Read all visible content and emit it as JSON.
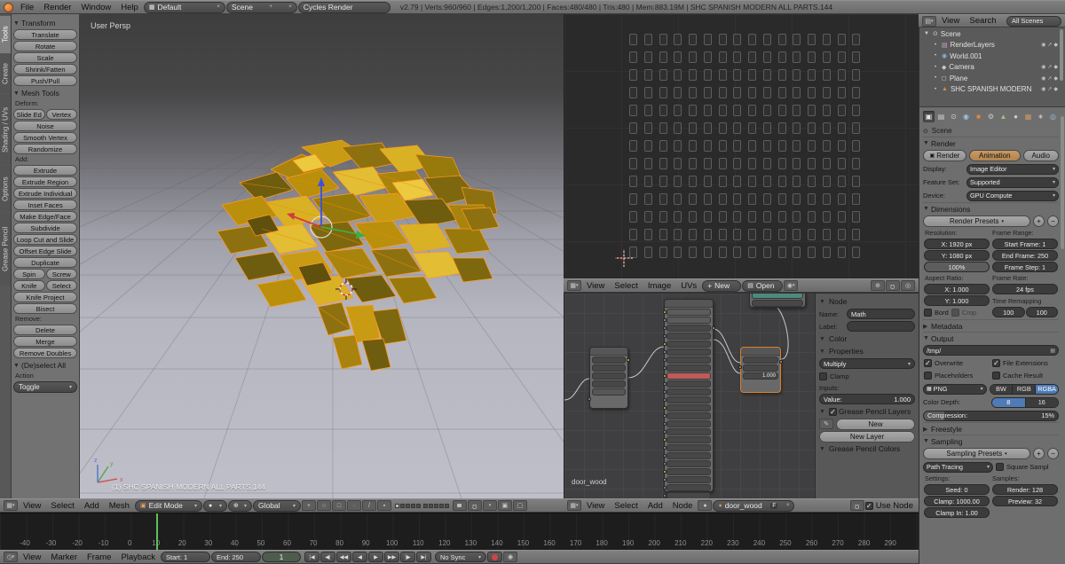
{
  "topbar": {
    "menus": [
      "File",
      "Render",
      "Window",
      "Help"
    ],
    "layout": "Default",
    "scene": "Scene",
    "engine": "Cycles Render",
    "stats": "v2.79 | Verts:960/960 | Edges:1,200/1,200 | Faces:480/480 | Tris:480 | Mem:883.19M | SHC SPANISH MODERN ALL PARTS.144"
  },
  "toolshelf": {
    "tabs": [
      "Tools",
      "Create",
      "Shading / UVs",
      "Options",
      "Grease Pencil"
    ],
    "items": [
      {
        "t": "header",
        "label": "Transform"
      },
      {
        "t": "btn",
        "label": "Translate"
      },
      {
        "t": "btn",
        "label": "Rotate"
      },
      {
        "t": "btn",
        "label": "Scale"
      },
      {
        "t": "btn",
        "label": "Shrink/Fatten"
      },
      {
        "t": "btn",
        "label": "Push/Pull"
      },
      {
        "t": "header",
        "label": "Mesh Tools"
      },
      {
        "t": "label",
        "label": "Deform:"
      },
      {
        "t": "row",
        "labels": [
          "Slide Ed",
          "Vertex"
        ]
      },
      {
        "t": "btn",
        "label": "Noise"
      },
      {
        "t": "btn",
        "label": "Smooth Vertex"
      },
      {
        "t": "btn",
        "label": "Randomize"
      },
      {
        "t": "label",
        "label": "Add:"
      },
      {
        "t": "btn",
        "label": "Extrude"
      },
      {
        "t": "btn",
        "label": "Extrude Region"
      },
      {
        "t": "btn",
        "label": "Extrude Individual"
      },
      {
        "t": "btn",
        "label": "Inset Faces"
      },
      {
        "t": "btn",
        "label": "Make Edge/Face"
      },
      {
        "t": "btn",
        "label": "Subdivide"
      },
      {
        "t": "btn",
        "label": "Loop Cut and Slide"
      },
      {
        "t": "btn",
        "label": "Offset Edge Slide"
      },
      {
        "t": "btn",
        "label": "Duplicate"
      },
      {
        "t": "row",
        "labels": [
          "Spin",
          "Screw"
        ]
      },
      {
        "t": "row",
        "labels": [
          "Knife",
          "Select"
        ]
      },
      {
        "t": "btn",
        "label": "Knife Project"
      },
      {
        "t": "btn",
        "label": "Bisect"
      },
      {
        "t": "label",
        "label": "Remove:"
      },
      {
        "t": "btn",
        "label": "Delete"
      },
      {
        "t": "btn",
        "label": "Merge"
      },
      {
        "t": "btn",
        "label": "Remove Doubles"
      },
      {
        "t": "header",
        "label": "(De)select All"
      },
      {
        "t": "label",
        "label": "Action"
      },
      {
        "t": "select",
        "label": "Toggle"
      }
    ]
  },
  "viewport": {
    "view_label": "User Persp",
    "object_label": "(1) SHC SPANISH MODERN ALL PARTS.144",
    "header": {
      "menus": [
        "View",
        "Select",
        "Add",
        "Mesh"
      ],
      "mode": "Edit Mode",
      "orientation": "Global"
    }
  },
  "uv_editor": {
    "header": {
      "menus": [
        "View",
        "Select",
        "Image",
        "UVs"
      ],
      "new_button": "New",
      "open_button": "Open"
    }
  },
  "node_editor": {
    "material_label": "door_wood",
    "math_node_value": "1.000",
    "header": {
      "menus": [
        "View",
        "Select",
        "Add",
        "Node"
      ],
      "material": "door_wood",
      "fake_user": "F",
      "use_nodes": "Use Node"
    },
    "n_panel": {
      "node_section": "Node",
      "name_label": "Name:",
      "name_value": "Math",
      "label_label": "Label:",
      "color_section": "Color",
      "properties_section": "Properties",
      "operation": "Multiply",
      "clamp_label": "Clamp",
      "inputs_label": "Inputs:",
      "value_label": "Value:",
      "value": "1.000",
      "gp_layers_section": "Grease Pencil Layers",
      "new_button": "New",
      "new_layer_button": "New Layer",
      "gp_colors_section": "Grease Pencil Colors"
    }
  },
  "outliner": {
    "header": {
      "menus": [
        "View",
        "Search"
      ],
      "scope": "All Scenes"
    },
    "items": [
      {
        "label": "Scene",
        "icon": "scene",
        "indent": 0,
        "expand": true,
        "trail": false
      },
      {
        "label": "RenderLayers",
        "icon": "renderlayers",
        "indent": 1,
        "expand": false,
        "trail": true
      },
      {
        "label": "World.001",
        "icon": "world",
        "indent": 1,
        "expand": false,
        "trail": false
      },
      {
        "label": "Camera",
        "icon": "camera",
        "indent": 1,
        "expand": false,
        "trail": true
      },
      {
        "label": "Plane",
        "icon": "plane",
        "indent": 1,
        "expand": false,
        "trail": true
      },
      {
        "label": "SHC SPANISH MODERN",
        "icon": "mesh",
        "indent": 1,
        "expand": false,
        "trail": true
      }
    ]
  },
  "properties": {
    "breadcrumb": "Scene",
    "render": {
      "section": "Render",
      "render_button": "Render",
      "animation_button": "Animation",
      "audio_button": "Audio",
      "display_label": "Display:",
      "display_value": "Image Editor",
      "feature_label": "Feature Set:",
      "feature_value": "Supported",
      "device_label": "Device:",
      "device_value": "GPU Compute"
    },
    "dimensions": {
      "section": "Dimensions",
      "presets": "Render Presets",
      "resolution_label": "Resolution:",
      "res_x": "X: 1920 px",
      "res_y": "Y: 1080 px",
      "res_scale": "100%",
      "frame_range_label": "Frame Range:",
      "start_frame": "Start Frame: 1",
      "end_frame": "End Frame: 250",
      "frame_step": "Frame Step: 1",
      "aspect_label": "Aspect Ratio:",
      "aspect_x": "X: 1.000",
      "aspect_y": "Y: 1.000",
      "frame_rate_label": "Frame Rate:",
      "fps": "24 fps",
      "time_remap_label": "Time Remapping",
      "time_remap_a": "100",
      "time_remap_b": "100",
      "border_label": "Bord",
      "crop_label": "Crop"
    },
    "metadata_section": "Metadata",
    "output": {
      "section": "Output",
      "path": "/tmp/",
      "overwrite": "Overwrite",
      "file_extensions": "File Extensions",
      "placeholders": "Placeholders",
      "cache_result": "Cache Result",
      "format": "PNG",
      "bw": "BW",
      "rgb": "RGB",
      "rgba": "RGBA",
      "color_depth_label": "Color Depth:",
      "depth_8": "8",
      "depth_16": "16",
      "compression_label": "Compression:",
      "compression_value": "15%"
    },
    "freestyle_section": "Freestyle",
    "sampling": {
      "section": "Sampling",
      "presets": "Sampling Presets",
      "integrator": "Path Tracing",
      "square_samples": "Square Sampl",
      "settings_label": "Settings:",
      "samples_label": "Samples:",
      "seed": "Seed: 0",
      "clamp": "Clamp: 1000.00",
      "clamp_indirect": "Clamp In: 1.00",
      "render_samples": "Render: 128",
      "preview_samples": "Preview: 32"
    }
  },
  "timeline": {
    "frame_numbers": [
      -40,
      -30,
      -20,
      -10,
      0,
      10,
      20,
      30,
      40,
      50,
      60,
      70,
      80,
      90,
      100,
      110,
      120,
      130,
      140,
      150,
      160,
      170,
      180,
      190,
      200,
      210,
      220,
      230,
      240,
      250,
      260,
      270,
      280,
      290
    ],
    "playhead_frame": 1,
    "header": {
      "menus": [
        "View",
        "Marker",
        "Frame",
        "Playback"
      ],
      "start": "Start: 1",
      "end": "End: 250",
      "current": "1",
      "sync": "No Sync",
      "transport": [
        {
          "name": "jump-to-start",
          "glyph": "|◀"
        },
        {
          "name": "jump-to-prev-keyframe",
          "glyph": "◀|"
        },
        {
          "name": "rewind",
          "glyph": "◀◀"
        },
        {
          "name": "play-reverse",
          "glyph": "◀"
        },
        {
          "name": "play",
          "glyph": "▶"
        },
        {
          "name": "fast-forward",
          "glyph": "▶▶"
        },
        {
          "name": "jump-to-next-keyframe",
          "glyph": "|▶"
        },
        {
          "name": "jump-to-end",
          "glyph": "▶|"
        }
      ]
    }
  },
  "colors": {
    "accent_orange": "#e0873c",
    "selection_blue": "#4e7ab5",
    "playhead_green": "#5cbf5c",
    "mesh_gold": "#c79b13",
    "wireframe_orange": "#ff9a1f"
  }
}
